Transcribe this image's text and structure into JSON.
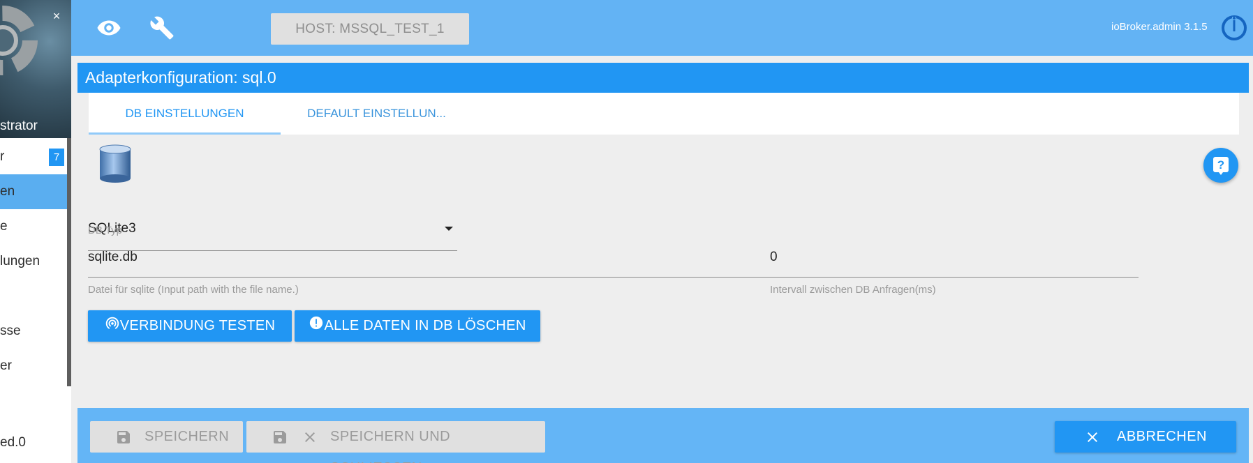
{
  "sidebar": {
    "close_label": "×",
    "title_fragment": "strator",
    "badge_count": "7",
    "items": [
      {
        "label": "r"
      },
      {
        "label": "en"
      },
      {
        "label": "e"
      },
      {
        "label": "lungen"
      },
      {
        "label": "sse"
      },
      {
        "label": "er"
      },
      {
        "label": "ed.0"
      }
    ]
  },
  "header": {
    "host_label": "HOST: MSSQL_TEST_1",
    "version": "ioBroker.admin 3.1.5",
    "icons": [
      "eye-icon",
      "wrench-icon",
      "power-icon"
    ]
  },
  "main": {
    "title": "Adapterkonfiguration: sql.0",
    "tabs": [
      {
        "label": "DB EINSTELLUNGEN",
        "active": true
      },
      {
        "label": "DEFAULT EINSTELLUN..."
      }
    ],
    "db_type": {
      "value": "SQLite3",
      "helper": "DB Typ"
    },
    "file_field": {
      "value": "sqlite.db",
      "helper": "Datei für sqlite (Input path with the file name.)"
    },
    "interval_field": {
      "value": "0",
      "helper": "Intervall zwischen DB Anfragen(ms)"
    },
    "buttons": {
      "test_connection": "VERBINDUNG TESTEN",
      "delete_all": "ALLE DATEN IN DB LÖSCHEN"
    }
  },
  "footer": {
    "save": "SPEICHERN",
    "save_close": "SPEICHERN UND SCHLIESSEN",
    "cancel": "ABBRECHEN"
  },
  "colors": {
    "primary": "#2196f3",
    "topbar": "#63b3f4",
    "footer": "#64b5f6",
    "background": "#eeeeee"
  }
}
